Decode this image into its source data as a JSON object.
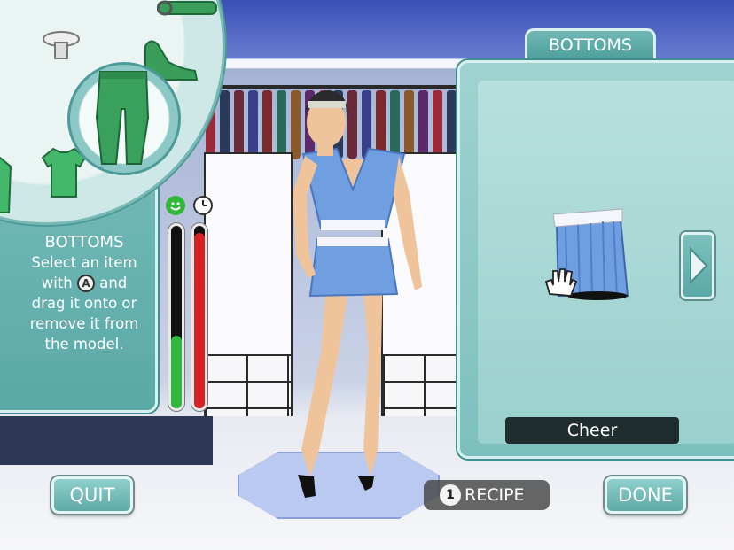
{
  "category_tab": "BOTTOMS",
  "instructions": {
    "heading": "BOTTOMS",
    "line1": "Select an item",
    "line2_pre": "with",
    "button_glyph": "A",
    "line2_post": "and",
    "line3": "drag it onto or",
    "line4": "remove it from",
    "line5": "the model."
  },
  "wheel": {
    "selected_icon": "pants-icon",
    "items": [
      "belt-icon",
      "shoe-icon",
      "hat-icon",
      "shirt-icon",
      "tshirt-icon",
      "dress-icon"
    ]
  },
  "meters": {
    "happy": {
      "icon": "smiley-icon",
      "level": 0.4,
      "color": "#2fb83a"
    },
    "time": {
      "icon": "clock-icon",
      "level": 0.96,
      "color": "#d62222"
    }
  },
  "item_preview": {
    "icon": "skirt-icon",
    "name": "Cheer",
    "cursor": "hand-cursor-icon"
  },
  "buttons": {
    "quit": "QUIT",
    "recipe_glyph": "1",
    "recipe": "RECIPE",
    "done": "DONE"
  },
  "colors": {
    "panel": "#5aa9a7",
    "panel_border": "#d8f0ef",
    "outfit": "#6f9fe0"
  }
}
